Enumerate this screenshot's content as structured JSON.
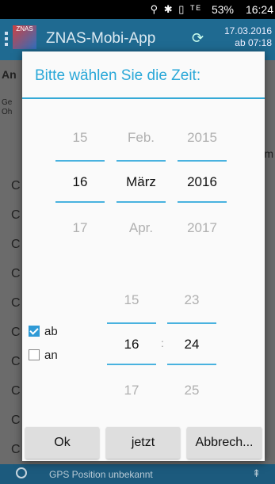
{
  "status_bar": {
    "icons": "⚲ ✱ ▯ ᵀᴱ",
    "battery": "53%",
    "time": "16:24"
  },
  "app_bar": {
    "logo_text": "ZNAS",
    "title": "ZNAS-Mobi-App",
    "refresh_icon": "⟳",
    "date_line1": "17.03.2016",
    "date_line2": "ab 07:18"
  },
  "background": {
    "label_a": "An",
    "label_ge": "Ge",
    "label_oh": "Oh",
    "right_m": "m",
    "row_letters": [
      "C",
      "C",
      "C",
      "C",
      "C",
      "C",
      "C",
      "C",
      "C",
      "C"
    ]
  },
  "dialog": {
    "title": "Bitte wählen Sie die Zeit:",
    "day": {
      "prev": "15",
      "selected": "16",
      "next": "17"
    },
    "month": {
      "prev": "Feb.",
      "selected": "März",
      "next": "Apr."
    },
    "year": {
      "prev": "2015",
      "selected": "2016",
      "next": "2017"
    },
    "hour": {
      "prev": "15",
      "selected": "16",
      "next": "17"
    },
    "minute": {
      "prev": "23",
      "selected": "24",
      "next": "25"
    },
    "separator": ":",
    "option_ab": {
      "label": "ab",
      "checked": true
    },
    "option_an": {
      "label": "an",
      "checked": false
    },
    "buttons": {
      "ok": "Ok",
      "now": "jetzt",
      "cancel": "Abbrech..."
    }
  },
  "bottom_bar": {
    "gps_text": "GPS Position unbekannt",
    "arrow": "⇞"
  },
  "colors": {
    "accent": "#35a9d6",
    "app_bar": "#1f6a91",
    "bottom_bar": "#1c5a7d"
  }
}
